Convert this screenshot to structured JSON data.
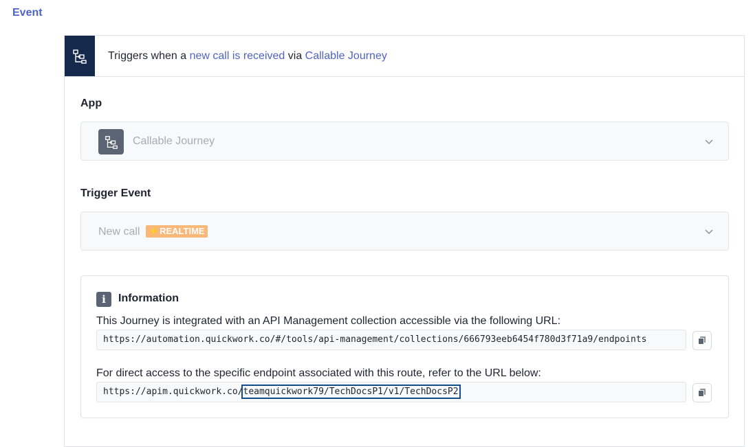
{
  "event_heading": "Event",
  "header": {
    "prefix": "Triggers when a ",
    "event_link": "new call is received",
    "middle": " via ",
    "app_link": "Callable Journey",
    "icon": "flow-diagram-icon"
  },
  "app_section": {
    "label": "App",
    "selected": "Callable Journey",
    "icon": "flow-diagram-icon"
  },
  "trigger_section": {
    "label": "Trigger Event",
    "selected": "New call",
    "badge": "REALTIME",
    "badge_icon": "lightning-icon"
  },
  "information": {
    "title": "Information",
    "desc1": "This Journey is integrated with an API Management collection accessible via the following URL:",
    "url1": "https://automation.quickwork.co/#/tools/api-management/collections/666793eeb6454f780d3f71a9/endpoints",
    "desc2": "For direct access to the specific endpoint associated with this route, refer to the URL below:",
    "url2_prefix": "https://apim.quickwork.co/",
    "url2_highlight": "teamquickwork79/TechDocsP1/v1/TechDocsP2",
    "copy_icon": "copy-icon"
  },
  "colors": {
    "accent": "#4f63c8",
    "header_icon_bg": "#14294b",
    "badge": "#f8b87a",
    "highlight_border": "#0f4c8c"
  }
}
